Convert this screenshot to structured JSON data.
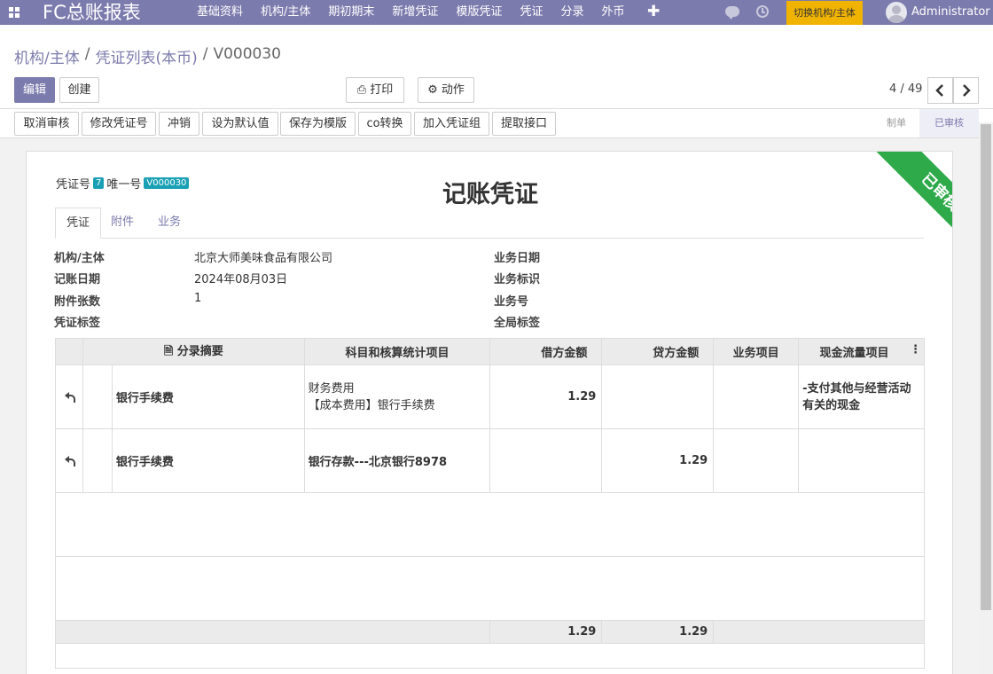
{
  "topbar": {
    "brand": "FC总账报表",
    "menu": [
      "基础资料",
      "机构/主体",
      "期初期末",
      "新增凭证",
      "模版凭证",
      "凭证",
      "分录",
      "外币"
    ],
    "switch_label": "切换机构/主体",
    "user": "Administrator"
  },
  "breadcrumb": {
    "items": [
      "机构/主体",
      "凭证列表(本币)",
      "V000030"
    ]
  },
  "toolbar": {
    "edit": "编辑",
    "create": "创建",
    "print": "打印",
    "action": "动作",
    "pager": "4 / 49"
  },
  "actions": [
    "取消审核",
    "修改凭证号",
    "冲销",
    "设为默认值",
    "保存为模版",
    "co转换",
    "加入凭证组",
    "提取接口"
  ],
  "status_steps": [
    "制单",
    "已审核"
  ],
  "voucher": {
    "no_label": "凭证号",
    "no": "7",
    "unique_label": "唯一号",
    "unique": "V000030",
    "title": "记账凭证",
    "ribbon": "已审核",
    "tabs": [
      "凭证",
      "附件",
      "业务"
    ]
  },
  "fields": {
    "org_label": "机构/主体",
    "org": "北京大师美味食品有限公司",
    "date_label": "记账日期",
    "date": "2024年08月03日",
    "attach_label": "附件张数",
    "attach": "1",
    "tag_label": "凭证标签",
    "biz_date_label": "业务日期",
    "biz_flag_label": "业务标识",
    "biz_no_label": "业务号",
    "global_tag_label": "全局标签"
  },
  "table": {
    "headers": [
      "分录摘要",
      "科目和核算统计项目",
      "借方金额",
      "贷方金额",
      "业务项目",
      "现金流量项目"
    ],
    "rows": [
      {
        "summary": "银行手续费",
        "account_1": "财务费用",
        "account_2": "【成本费用】银行手续费",
        "debit": "1.29",
        "credit": "",
        "cash_1": "-支付其他与经营活动",
        "cash_2": "有关的现金"
      },
      {
        "summary": "银行手续费",
        "account_1": "银行存款---北京银行8978",
        "account_2": "",
        "debit": "",
        "credit": "1.29",
        "cash_1": "",
        "cash_2": ""
      }
    ],
    "total_debit": "1.29",
    "total_credit": "1.29"
  }
}
